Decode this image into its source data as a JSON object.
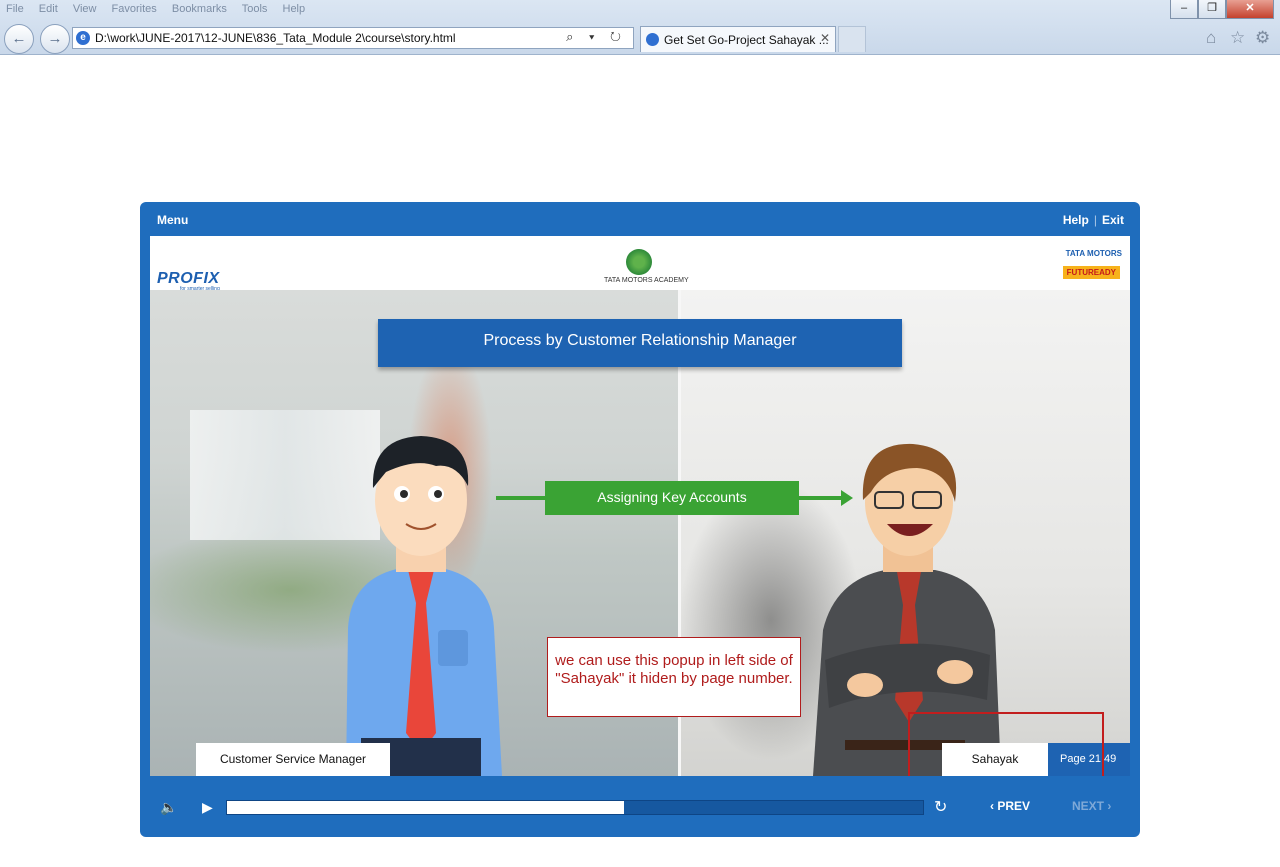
{
  "browser": {
    "menu": [
      "File",
      "Edit",
      "View",
      "Favorites",
      "Bookmarks",
      "Tools",
      "Help"
    ],
    "address": "D:\\work\\JUNE-2017\\12-JUNE\\836_Tata_Module 2\\course\\story.html",
    "address_tools": "⌕ ▾ ↻",
    "tab_title": "Get Set Go-Project Sahayak ...",
    "tab_close": "✕",
    "back": "←",
    "forward": "→",
    "win_min": "–",
    "win_max": "❐",
    "win_close": "✕",
    "home_icon": "⌂",
    "fav_icon": "☆",
    "settings_icon": "⚙"
  },
  "player": {
    "menu_label": "Menu",
    "help_label": "Help",
    "exit_label": "Exit",
    "separator": "|",
    "profix": "PROFIX",
    "profix_sub": "for smarter selling",
    "academy": "TATA MOTORS ACADEMY",
    "tata_motors": "TATA MOTORS",
    "futuready": "FUTUREADY",
    "slide_title": "Process by Customer Relationship Manager",
    "green_label": "Assigning Key Accounts",
    "popup_text": "we can use this popup in left side of \"Sahayak\" it hiden by page number.",
    "left_name": "Customer Service Manager",
    "right_name": "Sahayak",
    "page_label": "Page 21.49",
    "progress_fraction": 0.57,
    "volume_icon": "🔈",
    "play_icon": "▶",
    "replay_icon": "↻",
    "prev_label": "‹ PREV",
    "next_label": "NEXT ›"
  }
}
